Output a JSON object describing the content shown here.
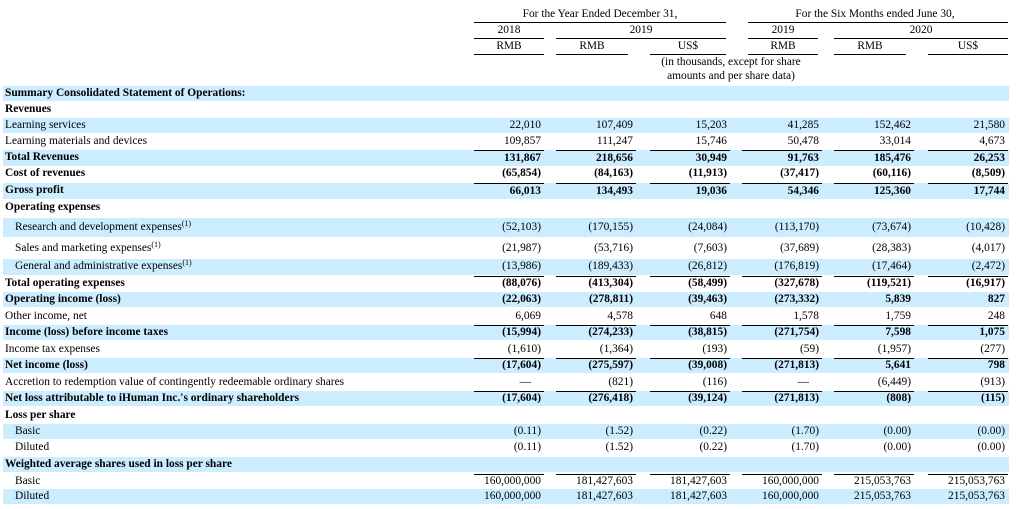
{
  "header": {
    "group_year": "For the Year Ended December 31,",
    "group_six": "For the Six Months ended June 30,",
    "year_2018": "2018",
    "year_2019": "2019",
    "six_2019": "2019",
    "six_2020": "2020",
    "currencies": [
      "RMB",
      "RMB",
      "US$",
      "RMB",
      "RMB",
      "US$"
    ],
    "note_line1": "(in thousands, except for share",
    "note_line2": "amounts and per share data)"
  },
  "rows": [
    {
      "label": "Summary Consolidated Statement of Operations:",
      "bold": true,
      "shaded": true,
      "indent": false,
      "values": [
        "",
        "",
        "",
        "",
        "",
        ""
      ]
    },
    {
      "label": "Revenues",
      "bold": true,
      "shaded": false,
      "indent": false,
      "values": [
        "",
        "",
        "",
        "",
        "",
        ""
      ]
    },
    {
      "label": "Learning services",
      "bold": false,
      "shaded": true,
      "indent": false,
      "values": [
        "22,010",
        "107,409",
        "15,203",
        "41,285",
        "152,462",
        "21,580"
      ]
    },
    {
      "label": "Learning materials and devices",
      "bold": false,
      "shaded": false,
      "indent": false,
      "values": [
        "109,857",
        "111,247",
        "15,746",
        "50,478",
        "33,014",
        "4,673"
      ]
    },
    {
      "label": "Total Revenues",
      "bold": true,
      "shaded": true,
      "indent": false,
      "values": [
        "131,867",
        "218,656",
        "30,949",
        "91,763",
        "185,476",
        "26,253"
      ]
    },
    {
      "label": "Cost of revenues",
      "bold": true,
      "shaded": false,
      "indent": false,
      "values": [
        "(65,854)",
        "(84,163)",
        "(11,913)",
        "(37,417)",
        "(60,116)",
        "(8,509)"
      ]
    },
    {
      "label": "Gross profit",
      "bold": true,
      "shaded": true,
      "indent": false,
      "values": [
        "66,013",
        "134,493",
        "19,036",
        "54,346",
        "125,360",
        "17,744"
      ]
    },
    {
      "label": "Operating expenses",
      "bold": true,
      "shaded": false,
      "indent": false,
      "values": [
        "",
        "",
        "",
        "",
        "",
        ""
      ]
    },
    {
      "label": "Research and development expenses",
      "note": "(1)",
      "bold": false,
      "shaded": true,
      "indent": true,
      "values": [
        "(52,103)",
        "(170,155)",
        "(24,084)",
        "(113,170)",
        "(73,674)",
        "(10,428)"
      ]
    },
    {
      "label": "Sales and marketing expenses",
      "note": "(1)",
      "bold": false,
      "shaded": false,
      "indent": true,
      "values": [
        "(21,987)",
        "(53,716)",
        "(7,603)",
        "(37,689)",
        "(28,383)",
        "(4,017)"
      ]
    },
    {
      "label": "General and administrative expenses",
      "note": "(1)",
      "bold": false,
      "shaded": true,
      "indent": true,
      "values": [
        "(13,986)",
        "(189,433)",
        "(26,812)",
        "(176,819)",
        "(17,464)",
        "(2,472)"
      ]
    },
    {
      "label": "Total operating expenses",
      "bold": true,
      "shaded": false,
      "indent": false,
      "values": [
        "(88,076)",
        "(413,304)",
        "(58,499)",
        "(327,678)",
        "(119,521)",
        "(16,917)"
      ]
    },
    {
      "label": "Operating income (loss)",
      "bold": true,
      "shaded": true,
      "indent": false,
      "values": [
        "(22,063)",
        "(278,811)",
        "(39,463)",
        "(273,332)",
        "5,839",
        "827"
      ]
    },
    {
      "label": "Other income, net",
      "bold": false,
      "shaded": false,
      "indent": false,
      "values": [
        "6,069",
        "4,578",
        "648",
        "1,578",
        "1,759",
        "248"
      ]
    },
    {
      "label": "Income (loss) before income taxes",
      "bold": true,
      "shaded": true,
      "indent": false,
      "values": [
        "(15,994)",
        "(274,233)",
        "(38,815)",
        "(271,754)",
        "7,598",
        "1,075"
      ]
    },
    {
      "label": "Income tax expenses",
      "bold": false,
      "shaded": false,
      "indent": false,
      "values": [
        "(1,610)",
        "(1,364)",
        "(193)",
        "(59)",
        "(1,957)",
        "(277)"
      ]
    },
    {
      "label": "Net income (loss)",
      "bold": true,
      "shaded": true,
      "indent": false,
      "values": [
        "(17,604)",
        "(275,597)",
        "(39,008)",
        "(271,813)",
        "5,641",
        "798"
      ]
    },
    {
      "label": "Accretion to redemption value of contingently redeemable ordinary shares",
      "bold": false,
      "shaded": false,
      "indent": false,
      "values": [
        "—",
        "(821)",
        "(116)",
        "—",
        "(6,449)",
        "(913)"
      ]
    },
    {
      "label": "Net loss attributable to iHuman Inc.'s ordinary shareholders",
      "bold": true,
      "shaded": true,
      "indent": false,
      "values": [
        "(17,604)",
        "(276,418)",
        "(39,124)",
        "(271,813)",
        "(808)",
        "(115)"
      ]
    },
    {
      "label": "Loss per share",
      "bold": true,
      "shaded": false,
      "indent": false,
      "values": [
        "",
        "",
        "",
        "",
        "",
        ""
      ]
    },
    {
      "label": "Basic",
      "bold": false,
      "shaded": true,
      "indent": true,
      "values": [
        "(0.11)",
        "(1.52)",
        "(0.22)",
        "(1.70)",
        "(0.00)",
        "(0.00)"
      ]
    },
    {
      "label": "Diluted",
      "bold": false,
      "shaded": false,
      "indent": true,
      "values": [
        "(0.11)",
        "(1.52)",
        "(0.22)",
        "(1.70)",
        "(0.00)",
        "(0.00)"
      ]
    },
    {
      "label": "Weighted average shares used in loss per share",
      "bold": true,
      "shaded": true,
      "indent": false,
      "values": [
        "",
        "",
        "",
        "",
        "",
        ""
      ]
    },
    {
      "label": "Basic",
      "bold": false,
      "shaded": false,
      "indent": true,
      "values": [
        "160,000,000",
        "181,427,603",
        "181,427,603",
        "160,000,000",
        "215,053,763",
        "215,053,763"
      ]
    },
    {
      "label": "Diluted",
      "bold": false,
      "shaded": true,
      "indent": true,
      "values": [
        "160,000,000",
        "181,427,603",
        "181,427,603",
        "160,000,000",
        "215,053,763",
        "215,053,763"
      ]
    }
  ]
}
